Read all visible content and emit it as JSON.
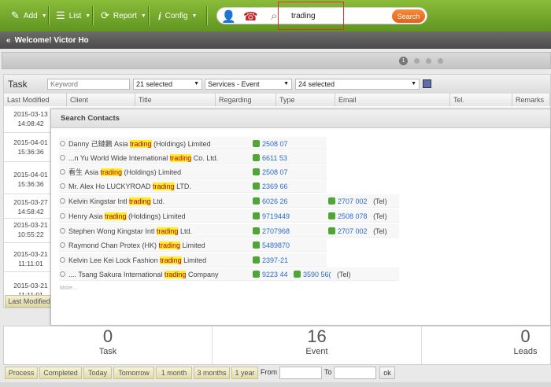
{
  "menu": {
    "add": "Add",
    "list": "List",
    "report": "Report",
    "config": "Config"
  },
  "search": {
    "value": "trading",
    "button": "Search"
  },
  "welcome": "Welcome! Victor Ho",
  "pager": {
    "current": "1"
  },
  "task": {
    "title": "Task",
    "keyword_placeholder": "Keyword",
    "select1": "21 selected",
    "select2": "Services - Event",
    "select3": "24 selected",
    "columns": [
      "Last Modified",
      "Client",
      "Title",
      "Regarding",
      "Type",
      "Email",
      "Tel.",
      "Remarks"
    ],
    "rows": [
      {
        "date": "2015-03-13",
        "time": "14:08:42"
      },
      {
        "date": "2015-04-01",
        "time": "15:36:36"
      },
      {
        "date": "2015-04-01",
        "time": "15:36:36"
      },
      {
        "date": "2015-03-27",
        "time": "14:58:42"
      },
      {
        "date": "2015-03-21",
        "time": "10:55:22"
      },
      {
        "date": "2015-03-21",
        "time": "11:11:01"
      },
      {
        "date": "2015-03-21",
        "time": "11:11:01"
      }
    ],
    "last_modified_btn": "Last Modified"
  },
  "popup": {
    "title": "Search Contacts",
    "more": "More...",
    "contacts": [
      {
        "pre": "Danny 己鏈鵝 Asia ",
        "hl": "trading",
        "post": " (Holdings) Limited",
        "tels": [
          "2508 07"
        ]
      },
      {
        "pre": "...n Yu World Wide International ",
        "hl": "trading",
        "post": " Co. Ltd.",
        "tels": [
          "6611 53"
        ]
      },
      {
        "pre": "看生 Asia ",
        "hl": "trading",
        "post": " (Holdings) Limited",
        "tels": [
          "2508 07"
        ]
      },
      {
        "pre": "Mr. Alex Ho LUCKYROAD ",
        "hl": "trading",
        "post": " LTD.",
        "tels": [
          "2369 66"
        ]
      },
      {
        "pre": "Kelvin Kingstar Intl ",
        "hl": "trading",
        "post": " Ltd.",
        "tels": [
          "6026 26",
          "2707 002"
        ]
      },
      {
        "pre": "Henry Asia ",
        "hl": "trading",
        "post": " (Holdings) Limited",
        "tels": [
          "9719449",
          "2508 078"
        ]
      },
      {
        "pre": "Stephen Wong Kingstar Intl ",
        "hl": "trading",
        "post": " Ltd.",
        "tels": [
          "2707968",
          "2707 002"
        ]
      },
      {
        "pre": "Raymond Chan Protex (HK) ",
        "hl": "trading",
        "post": " Limited",
        "tels": [
          "5489870"
        ]
      },
      {
        "pre": "Kelvin Lee Kei Lock Fashion ",
        "hl": "trading",
        "post": " Limited",
        "tels": [
          "2397-21"
        ]
      },
      {
        "pre": ".... Tsang Sakura International ",
        "hl": "trading",
        "post": " Company",
        "tels": [
          "9223 44",
          "3590 56("
        ]
      }
    ],
    "tel_label": "(Tel)"
  },
  "stats": [
    {
      "num": "0",
      "label": "Task"
    },
    {
      "num": "16",
      "label": "Event"
    },
    {
      "num": "0",
      "label": "Leads"
    }
  ],
  "footer": {
    "buttons": [
      "Process",
      "Completed",
      "Today",
      "Tomorrow",
      "1 month",
      "3 months",
      "1 year"
    ],
    "from": "From",
    "to": "To",
    "ok": "ok"
  },
  "colors": {
    "brand_green": "#6fa82a",
    "search_orange": "#e8701f",
    "highlight": "#ffef20"
  }
}
